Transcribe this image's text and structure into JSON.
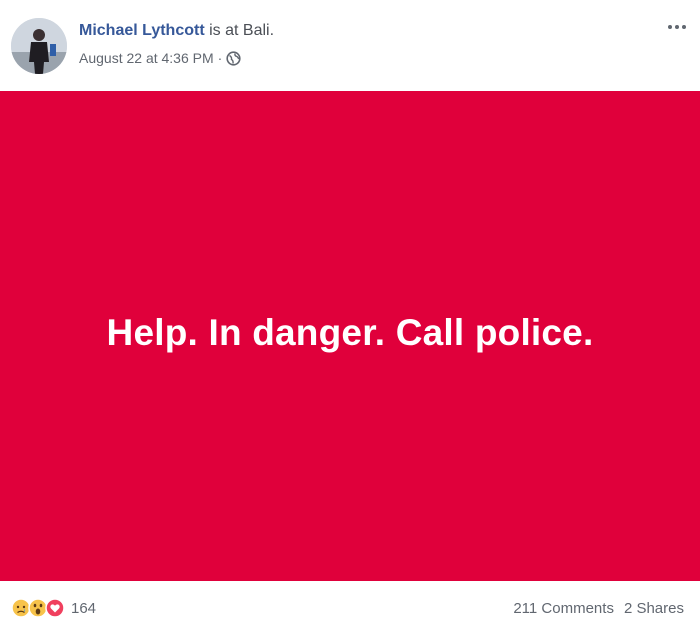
{
  "post": {
    "author": "Michael Lythcott",
    "location_prefix": "is at",
    "location": "Bali.",
    "timestamp": "August 22 at 4:36 PM",
    "meta_separator": "·",
    "privacy_icon": "globe-icon",
    "more_icon": "more-options-icon",
    "image_text": "Help. In danger. Call police.",
    "image_background": "#e0003b",
    "author_color": "#365899"
  },
  "footer": {
    "reaction_icons": [
      "sad-reaction-icon",
      "wow-reaction-icon",
      "love-reaction-icon"
    ],
    "reaction_count": "164",
    "comments": "211 Comments",
    "shares": "2 Shares"
  }
}
